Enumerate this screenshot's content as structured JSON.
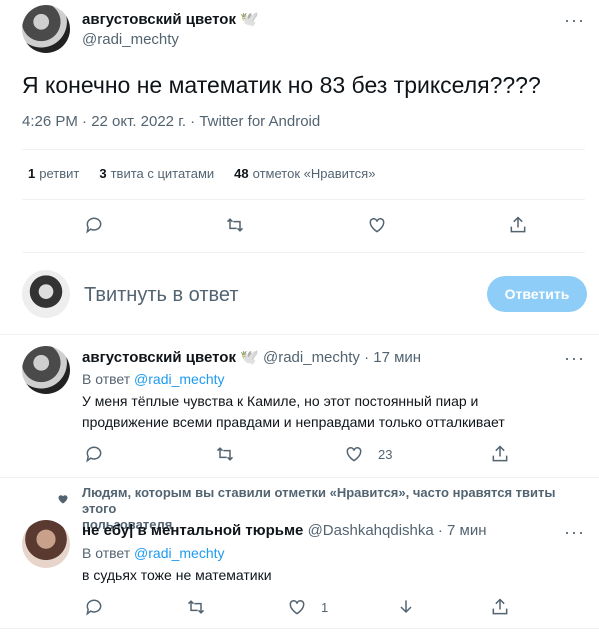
{
  "main_tweet": {
    "author_name": "августовский цветок",
    "author_emoji": "🕊️",
    "handle": "@radi_mechty",
    "more_label": "···",
    "text": "Я конечно не математик но 83 без трикселя????",
    "timestamp": "4:26 PM · 22 окт. 2022 г. · Twitter for Android",
    "stats": {
      "retweets_count": "1",
      "retweets_label": "ретвит",
      "quotes_count": "3",
      "quotes_label": "твита с цитатами",
      "likes_count": "48",
      "likes_label": "отметок «Нравится»"
    }
  },
  "reply_box": {
    "placeholder": "Твитнуть в ответ",
    "button_label": "Ответить"
  },
  "replies": [
    {
      "author_name": "августовский цветок",
      "author_emoji": "🕊️",
      "handle_time": "@radi_mechty · 17 мин",
      "in_reply_prefix": "В ответ",
      "in_reply_handle": "@radi_mechty",
      "text_line1": "У меня тёплые чувства к Камиле, но этот постоянный пиар и",
      "text_line2": "продвижение всеми правдами и неправдами только отталкивает",
      "reply_count": "",
      "retweet_count": "",
      "like_count": "23"
    },
    {
      "social_context_line1": "Людям, которым вы ставили отметки «Нравится», часто нравятся твиты этого",
      "social_context_line2": "пользователя",
      "author_name": "не ебу| в ментальной тюрьме",
      "handle_time": "@Dashkahqdishka · 7 мин",
      "in_reply_prefix": "В ответ",
      "in_reply_handle": "@radi_mechty",
      "text_line1": "в судьях тоже не математики",
      "like_count": "1"
    }
  ]
}
